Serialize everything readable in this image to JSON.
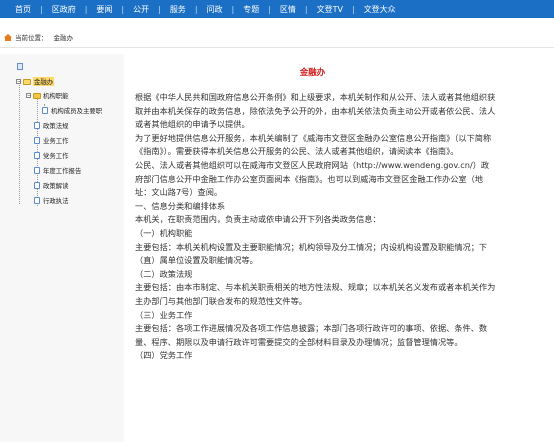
{
  "topnav": {
    "items": [
      "首页",
      "区政府",
      "要闻",
      "公开",
      "服务",
      "问政",
      "专题",
      "区情",
      "文登TV",
      "文登大众"
    ]
  },
  "breadcrumb": {
    "prefix": "当前位置：",
    "current": "金融办"
  },
  "tree": {
    "root": "金融办",
    "children": [
      {
        "label": "机构职能",
        "expandable": true
      },
      {
        "label": "机构成员及主要职",
        "sub": true
      },
      {
        "label": "政策法规"
      },
      {
        "label": "业务工作"
      },
      {
        "label": "党务工作"
      },
      {
        "label": "年度工作报告"
      },
      {
        "label": "政策解读"
      },
      {
        "label": "行政执法"
      }
    ]
  },
  "article": {
    "title": "金融办",
    "paragraphs": [
      "根据《中华人民共和国政府信息公开条例》和上级要求，本机关制作和从公开、法人或者其他组织获取并由本机关保存的政务信息，除依法免予公开的外，由本机关依法负责主动公开或者依公民、法人或者其他组织的申请予以提供。",
      "为了更好地提供信息公开服务，本机关编制了《威海市文登区金融办公室信息公开指南》（以下简称《指南》）。需要获得本机关信息公开服务的公民、法人或者其他组织，请阅读本《指南》。",
      "公民、法人或者其他组织可以在威海市文登区人民政府网站（http://www.wendeng.gov.cn/）政府部门信息公开中金融工作办公室页面阅本《指南》。也可以到威海市文登区金融工作办公室（地址：文山路7号）查阅。",
      "一、信息分类和编排体系",
      "本机关，在职责范围内，负责主动或依申请公开下列各类政务信息：",
      "（一）机构职能",
      "主要包括：本机关机构设置及主要职能情况；机构领导及分工情况；内设机构设置及职能情况；下（直）属单位设置及职能情况等。",
      "（二）政策法规",
      "主要包括：由本市制定、与本机关职责相关的地方性法规、规章；以本机关名义发布或者本机关作为主办部门与其他部门联合发布的规范性文件等。",
      "（三）业务工作",
      "主要包括：各项工作进展情况及各项工作信息披露；本部门各项行政许可的事项、依据、条件、数量、程序、期限以及申请行政许可需要提交的全部材料目录及办理情况；监督管理情况等。",
      "（四）党务工作"
    ]
  }
}
